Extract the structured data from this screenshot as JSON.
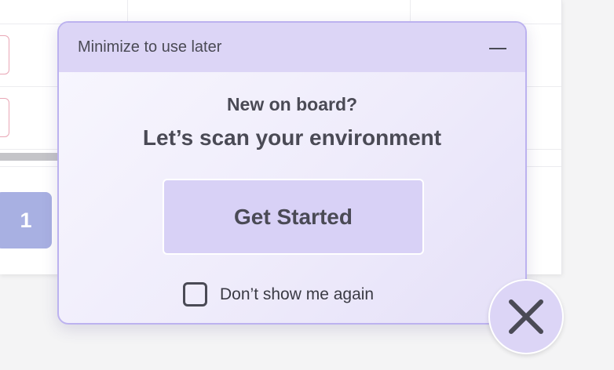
{
  "background": {
    "pagination_current": "1"
  },
  "popup": {
    "header_title": "Minimize to use later",
    "line1": "New on board?",
    "line2": "Let’s scan your environment",
    "cta_label": "Get Started",
    "dont_show_label": "Don’t show me again",
    "dont_show_checked": false
  },
  "icons": {
    "minimize": "minimize-icon",
    "close": "close-icon"
  },
  "colors": {
    "header_bg": "#dcd5f6",
    "accent_border": "#bcb2ef",
    "cta_bg": "#d8d1f6",
    "text": "#4a4a55",
    "pagination_bg": "#a8b0e2"
  }
}
